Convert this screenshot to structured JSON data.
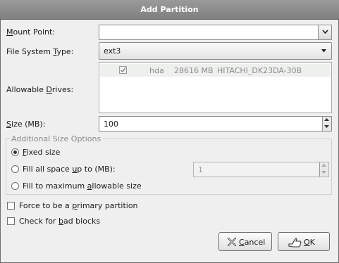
{
  "window": {
    "title": "Add Partition"
  },
  "mount_point": {
    "label_pre": "",
    "label_u": "M",
    "label_post": "ount Point:",
    "value": ""
  },
  "fs_type": {
    "label_pre": "File System ",
    "label_u": "T",
    "label_post": "ype:",
    "value": "ext3"
  },
  "drives": {
    "label_pre": "Allowable ",
    "label_u": "D",
    "label_post": "rives:",
    "rows": [
      {
        "checked": true,
        "name": "hda",
        "size": "28616 MB",
        "model": "HITACHI_DK23DA-30B"
      }
    ]
  },
  "size": {
    "label_pre": "",
    "label_u": "S",
    "label_post": "ize (MB):",
    "value": "100"
  },
  "additional": {
    "legend": "Additional Size Options",
    "fixed": {
      "pre": "",
      "u": "F",
      "post": "ixed size",
      "selected": true
    },
    "fill_upto": {
      "pre": "Fill all space ",
      "u": "u",
      "post": "p to (MB):",
      "selected": false,
      "value": "1"
    },
    "fill_max": {
      "pre": "Fill to maximum ",
      "u": "a",
      "post": "llowable size",
      "selected": false
    }
  },
  "primary": {
    "pre": "Force to be a ",
    "u": "p",
    "post": "rimary partition",
    "checked": false
  },
  "badblocks": {
    "pre": "Check for ",
    "u": "b",
    "post": "ad blocks",
    "checked": false
  },
  "buttons": {
    "cancel": {
      "u": "C",
      "post": "ancel"
    },
    "ok": {
      "u": "O",
      "post": "K"
    }
  },
  "icons": {
    "cancel": "cancel-x-icon",
    "ok": "ok-hand-icon"
  }
}
